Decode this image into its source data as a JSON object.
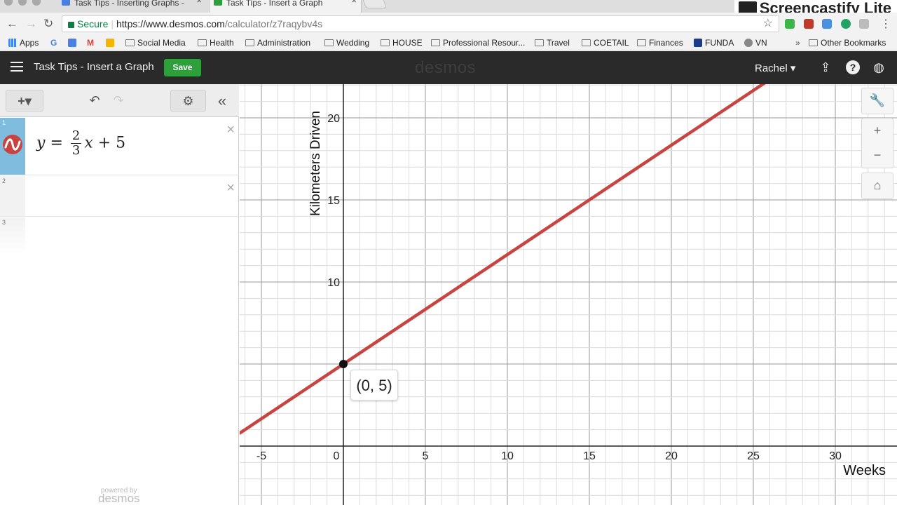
{
  "browser": {
    "tabs": [
      {
        "title": "Task Tips - Inserting Graphs -",
        "active": false
      },
      {
        "title": "Task Tips - Insert a Graph",
        "active": true
      }
    ],
    "close_glyph": "×",
    "overlay_logo": "Screencastify Lite",
    "secure_label": "Secure",
    "url_host": "https://www.desmos.com",
    "url_path": "/calculator/z7raqybv4s",
    "bookmarks": [
      {
        "label": "Apps",
        "icon": "apps-grid-icon"
      },
      {
        "label": "",
        "icon": "google-icon"
      },
      {
        "label": "",
        "icon": "inbox-icon"
      },
      {
        "label": "",
        "icon": "gmail-icon"
      },
      {
        "label": "",
        "icon": "keep-icon"
      },
      {
        "label": "Social Media",
        "icon": "folder-icon"
      },
      {
        "label": "Health",
        "icon": "folder-icon"
      },
      {
        "label": "Administration",
        "icon": "folder-icon"
      },
      {
        "label": "Wedding",
        "icon": "folder-icon"
      },
      {
        "label": "HOUSE",
        "icon": "folder-icon"
      },
      {
        "label": "Professional Resour...",
        "icon": "folder-icon"
      },
      {
        "label": "Travel",
        "icon": "folder-icon"
      },
      {
        "label": "COETAIL",
        "icon": "folder-icon"
      },
      {
        "label": "Finances",
        "icon": "folder-icon"
      },
      {
        "label": "FUNDA",
        "icon": "site-icon"
      },
      {
        "label": "VN",
        "icon": "site-icon"
      }
    ],
    "overflow_glyph": "»",
    "other_bookmarks": "Other Bookmarks"
  },
  "desmos": {
    "title": "Task Tips - Insert a Graph",
    "save_label": "Save",
    "brand": "desmos",
    "user": "Rachel ▾",
    "help_glyph": "?"
  },
  "panel": {
    "add_label": "+▾",
    "expressions": [
      {
        "num": "1",
        "latex": "y = 2/3 x + 5",
        "lhs": "y",
        "eq": "=",
        "num_frac": "2",
        "den_frac": "3",
        "var": "x",
        "rest": "+ 5",
        "color": "#c74440"
      },
      {
        "num": "2"
      },
      {
        "num": "3"
      }
    ],
    "powered_by": "powered by",
    "powered_logo": "desmos"
  },
  "graph": {
    "y_axis_label": "Kilometers Driven",
    "x_axis_label": "Weeks",
    "x_ticks": [
      "-5",
      "0",
      "5",
      "10",
      "15",
      "20",
      "25",
      "30"
    ],
    "y_ticks": [
      "10",
      "15",
      "20"
    ],
    "tooltip": "(0, 5)",
    "line_color": "#c74440",
    "zoom_in": "+",
    "zoom_out": "−"
  },
  "chart_data": {
    "type": "line",
    "title": "",
    "xlabel": "Weeks",
    "ylabel": "Kilometers Driven",
    "xlim": [
      -6.3,
      33.7
    ],
    "ylim": [
      -3.5,
      22
    ],
    "equation": "y = 2/3 x + 5",
    "series": [
      {
        "name": "y = 2/3 x + 5",
        "slope": 0.6667,
        "intercept": 5
      }
    ],
    "highlight_point": {
      "x": 0,
      "y": 5,
      "label": "(0, 5)"
    },
    "grid": true
  }
}
